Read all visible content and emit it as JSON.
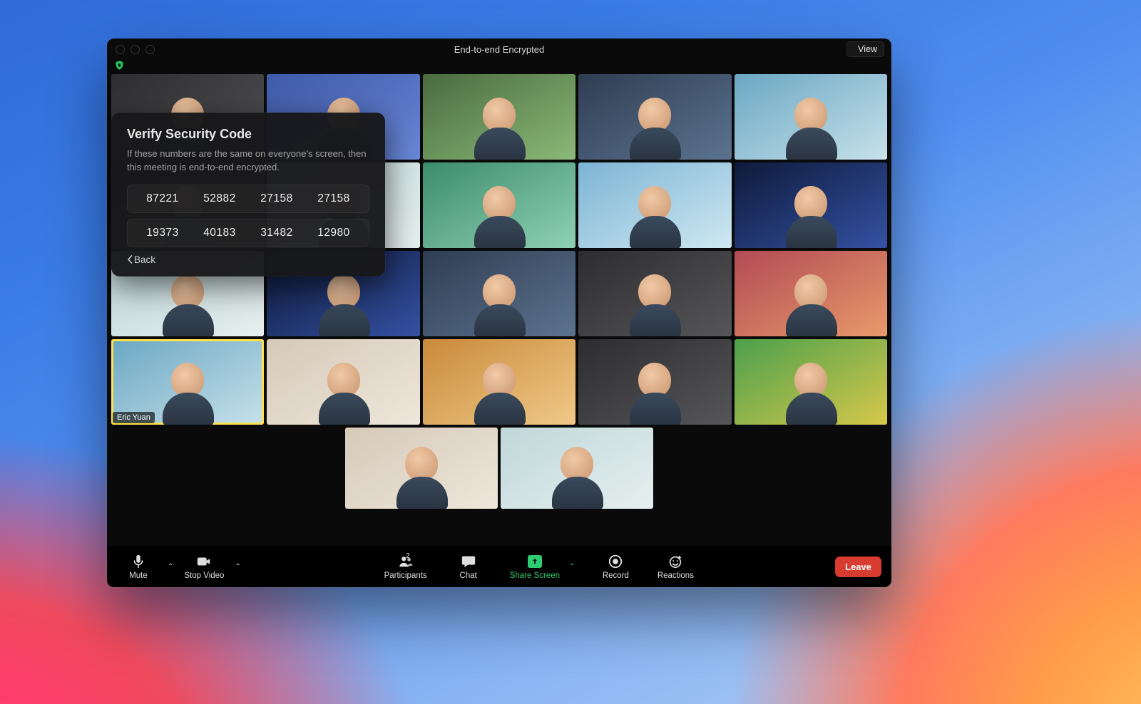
{
  "window": {
    "title": "End-to-end Encrypted",
    "view_button": "View"
  },
  "security_popover": {
    "heading": "Verify Security Code",
    "description": "If these numbers are the same on everyone's screen, then this meeting is end-to-end encrypted.",
    "codes_row1": [
      "87221",
      "52882",
      "27158",
      "27158"
    ],
    "codes_row2": [
      "19373",
      "40183",
      "31482",
      "12980"
    ],
    "back_label": "Back"
  },
  "gallery": {
    "active_speaker": "Eric Yuan"
  },
  "toolbar": {
    "mute": "Mute",
    "stop_video": "Stop Video",
    "participants": "Participants",
    "participants_count": "2",
    "chat": "Chat",
    "share_screen": "Share Screen",
    "record": "Record",
    "reactions": "Reactions",
    "leave": "Leave"
  }
}
